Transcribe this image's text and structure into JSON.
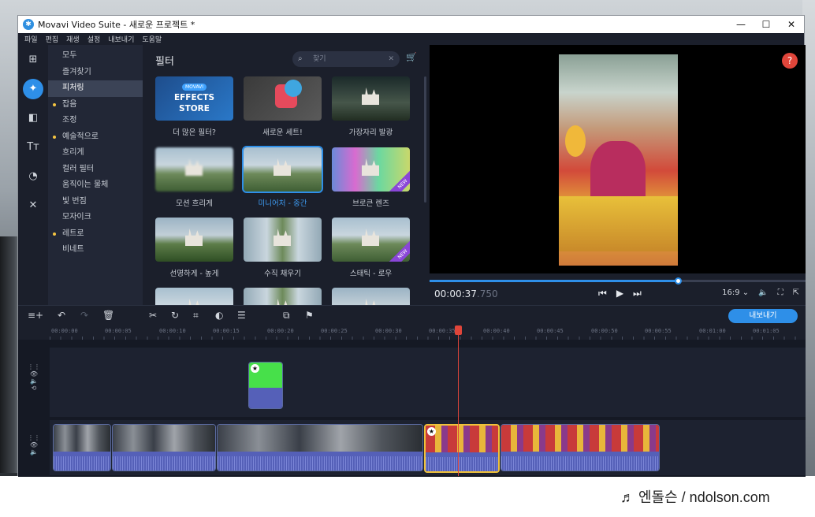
{
  "window": {
    "title": "Movavi Video Suite - 새로운 프로젝트 *",
    "controls": [
      "—",
      "☐",
      "✕"
    ]
  },
  "menu": [
    "파일",
    "편집",
    "재생",
    "설정",
    "내보내기",
    "도움말"
  ],
  "rail_icons": [
    "import-icon",
    "filters-icon",
    "transitions-icon",
    "titles-icon",
    "stickers-icon",
    "tools-icon"
  ],
  "categories": [
    {
      "label": "모두",
      "dot": false
    },
    {
      "label": "즐겨찾기",
      "dot": false
    },
    {
      "label": "피처링",
      "dot": false,
      "active": true
    },
    {
      "label": "잡음",
      "dot": true
    },
    {
      "label": "조정",
      "dot": false
    },
    {
      "label": "예술적으로",
      "dot": true
    },
    {
      "label": "흐리게",
      "dot": false
    },
    {
      "label": "컬러 필터",
      "dot": false
    },
    {
      "label": "움직이는 물체",
      "dot": false
    },
    {
      "label": "빛 번짐",
      "dot": false
    },
    {
      "label": "모자이크",
      "dot": false
    },
    {
      "label": "레트로",
      "dot": true
    },
    {
      "label": "비네트",
      "dot": false
    }
  ],
  "filters": {
    "title": "필터",
    "search_placeholder": "찾기",
    "store": {
      "movavi": "MOVAVI",
      "line1": "EFFECTS",
      "line2": "STORE"
    },
    "new_badge": "NEW",
    "tiles": [
      {
        "label": "더 많은 필터?"
      },
      {
        "label": "새로운 세트!"
      },
      {
        "label": "가장자리 발광"
      },
      {
        "label": "모션 흐리게"
      },
      {
        "label": "미니어처 - 중간",
        "selected": true
      },
      {
        "label": "브로큰 렌즈"
      },
      {
        "label": "선명하게 - 높게"
      },
      {
        "label": "수직 채우기"
      },
      {
        "label": "스태틱 - 로우"
      }
    ]
  },
  "preview": {
    "help": "?",
    "timecode_main": "00:00:37",
    "timecode_ms": ".750",
    "progress": 0.66,
    "aspect": "16:9 ⌄"
  },
  "timeline": {
    "export_label": "내보내기",
    "ruler": [
      "00:00:00",
      "00:00:05",
      "00:00:10",
      "00:00:15",
      "00:00:20",
      "00:00:25",
      "00:00:30",
      "00:00:35",
      "00:00:40",
      "00:00:45",
      "00:00:50",
      "00:00:55",
      "00:01:00",
      "00:01:05"
    ]
  },
  "watermark": "♬ 엔돌슨 / ndolson.com",
  "colors": {
    "accent": "#2e8fe8",
    "playhead": "#e0453a",
    "selected_clip": "#f0c23a"
  }
}
